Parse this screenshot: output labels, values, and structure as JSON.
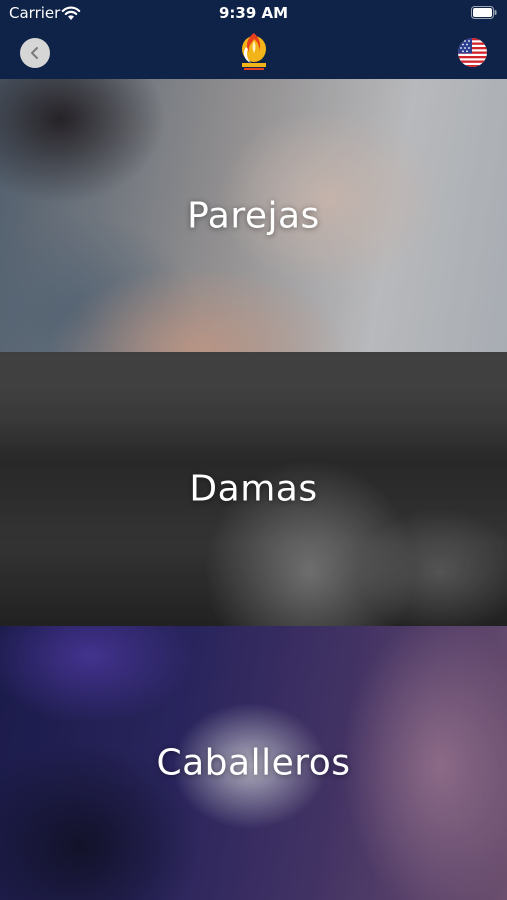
{
  "status_bar": {
    "carrier": "Carrier",
    "time": "9:39 AM",
    "wifi_icon": "wifi-icon",
    "battery_icon": "battery-icon"
  },
  "nav": {
    "back_icon": "chevron-left-icon",
    "logo_icon": "church-flame-logo",
    "language_icon": "us-flag-icon"
  },
  "tiles": [
    {
      "label": "Parejas"
    },
    {
      "label": "Damas"
    },
    {
      "label": "Caballeros"
    }
  ],
  "colors": {
    "nav_background": "#0e2347",
    "back_button": "#d6d6d6",
    "label_text": "#ffffff"
  }
}
